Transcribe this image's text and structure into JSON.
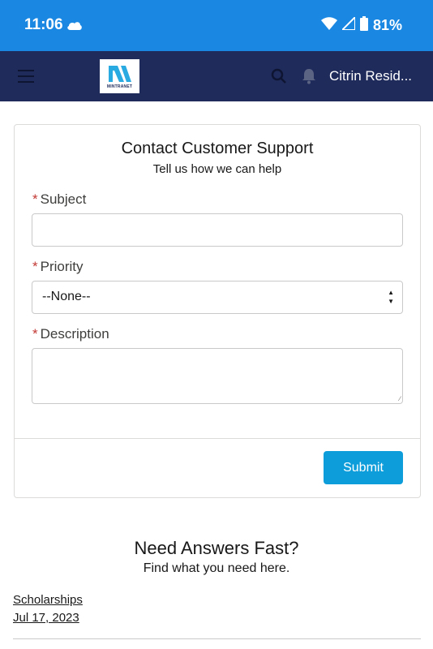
{
  "status_bar": {
    "time": "11:06",
    "battery": "81%",
    "icons": [
      "cloud-icon",
      "wifi-icon",
      "signal-icon",
      "battery-icon"
    ]
  },
  "header": {
    "logo_text": "MINTRANET",
    "user_name": "Citrin Resid...",
    "icons": [
      "menu-icon",
      "search-icon",
      "bell-icon"
    ]
  },
  "form": {
    "title": "Contact Customer Support",
    "subtitle": "Tell us how we can help",
    "required_marker": "*",
    "subject_label": "Subject",
    "subject_value": "",
    "priority_label": "Priority",
    "priority_value": "--None--",
    "description_label": "Description",
    "description_value": "",
    "submit_label": "Submit"
  },
  "faq": {
    "title": "Need Answers Fast?",
    "subtitle": "Find what you need here.",
    "article_title": "Scholarships",
    "article_date": "Jul 17, 2023"
  },
  "colors": {
    "status_bar": "#1a88e3",
    "header": "#1f2b5b",
    "submit": "#0d9dda",
    "required": "#c23934"
  }
}
